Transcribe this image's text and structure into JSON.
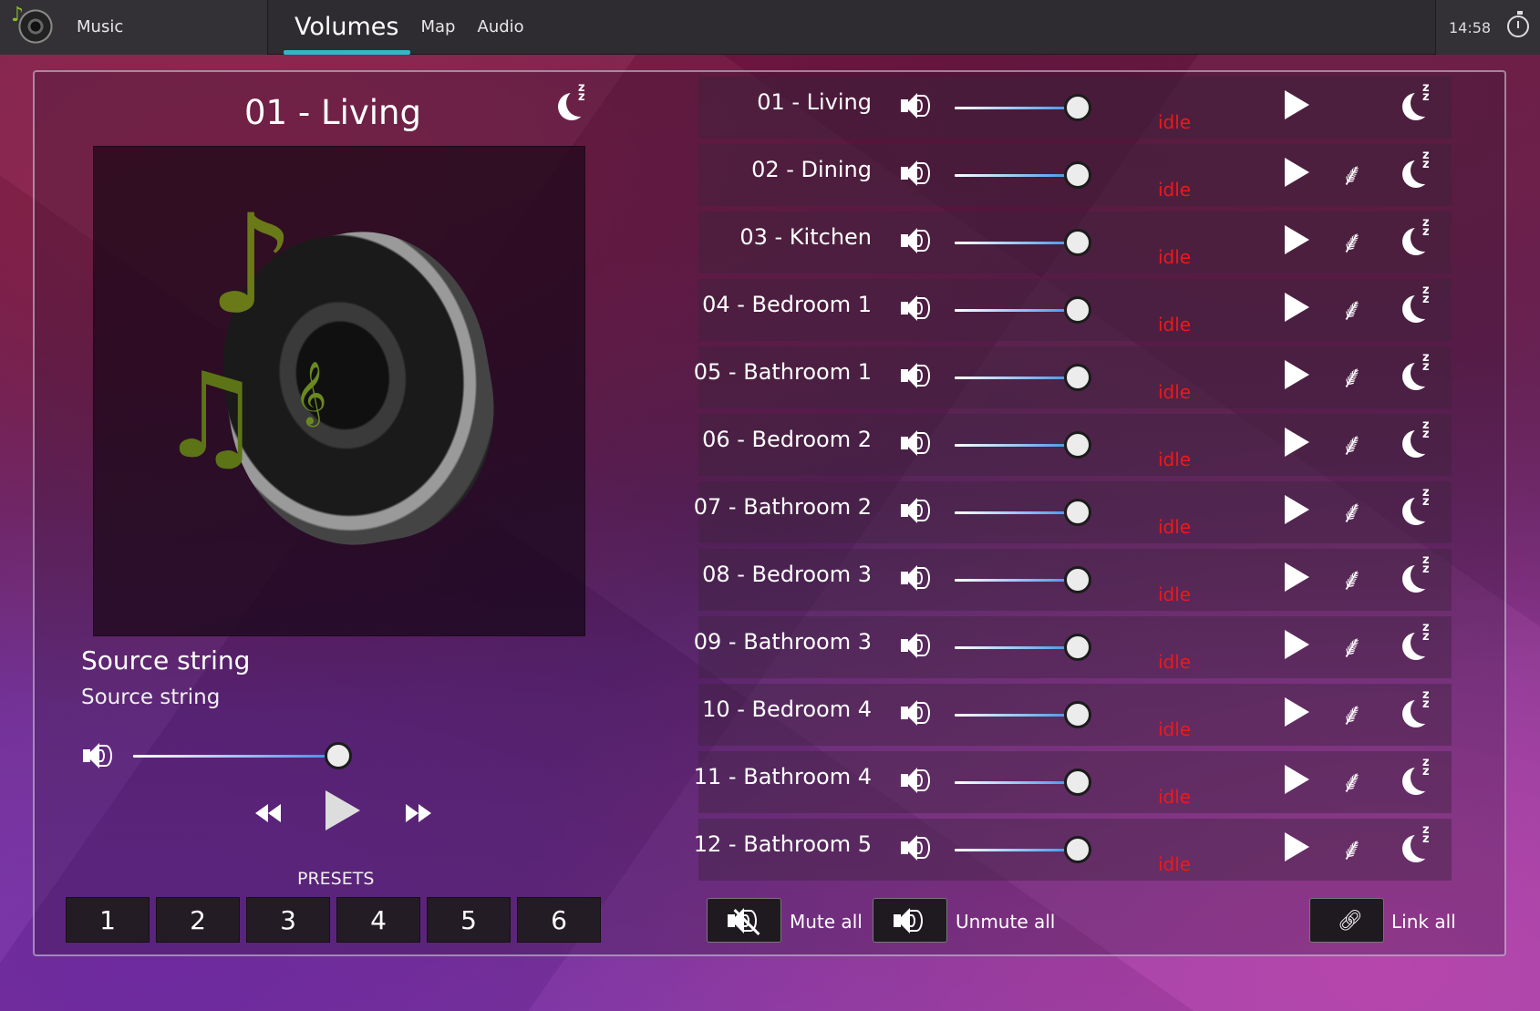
{
  "app": {
    "title": "Music"
  },
  "tabs": [
    {
      "label": "Volumes",
      "active": true
    },
    {
      "label": "Map",
      "active": false
    },
    {
      "label": "Audio",
      "active": false
    }
  ],
  "clock": "14:58",
  "player": {
    "zone_title": "01 - Living",
    "source_line_1": "Source string",
    "source_line_2": "Source string",
    "volume_percent": 100,
    "presets_label": "PRESETS",
    "presets": [
      "1",
      "2",
      "3",
      "4",
      "5",
      "6"
    ]
  },
  "zones": [
    {
      "name": "01 - Living",
      "status": "idle",
      "volume_percent": 100,
      "has_link": false
    },
    {
      "name": "02 - Dining",
      "status": "idle",
      "volume_percent": 100,
      "has_link": true
    },
    {
      "name": "03 - Kitchen",
      "status": "idle",
      "volume_percent": 100,
      "has_link": true
    },
    {
      "name": "04 - Bedroom 1",
      "status": "idle",
      "volume_percent": 100,
      "has_link": true
    },
    {
      "name": "05 - Bathroom 1",
      "status": "idle",
      "volume_percent": 100,
      "has_link": true
    },
    {
      "name": "06 - Bedroom 2",
      "status": "idle",
      "volume_percent": 100,
      "has_link": true
    },
    {
      "name": "07 - Bathroom 2",
      "status": "idle",
      "volume_percent": 100,
      "has_link": true
    },
    {
      "name": "08 - Bedroom 3",
      "status": "idle",
      "volume_percent": 100,
      "has_link": true
    },
    {
      "name": "09 - Bathroom 3",
      "status": "idle",
      "volume_percent": 100,
      "has_link": true
    },
    {
      "name": "10 - Bedroom 4",
      "status": "idle",
      "volume_percent": 100,
      "has_link": true
    },
    {
      "name": "11 - Bathroom 4",
      "status": "idle",
      "volume_percent": 100,
      "has_link": true
    },
    {
      "name": "12 - Bathroom 5",
      "status": "idle",
      "volume_percent": 100,
      "has_link": true
    }
  ],
  "actions": {
    "mute_all": "Mute all",
    "unmute_all": "Unmute all",
    "link_all": "Link all"
  },
  "colors": {
    "accent": "#2fb6c9",
    "status_idle": "#f01818",
    "slider_fill": "#3a8fe6"
  },
  "icons": [
    "music-speaker-logo",
    "timer-icon",
    "sleep-moon-icon",
    "speaker-volume-icon",
    "play-icon",
    "rewind-icon",
    "fast-forward-icon",
    "link-icon",
    "mute-icon",
    "chain-link-icon"
  ]
}
